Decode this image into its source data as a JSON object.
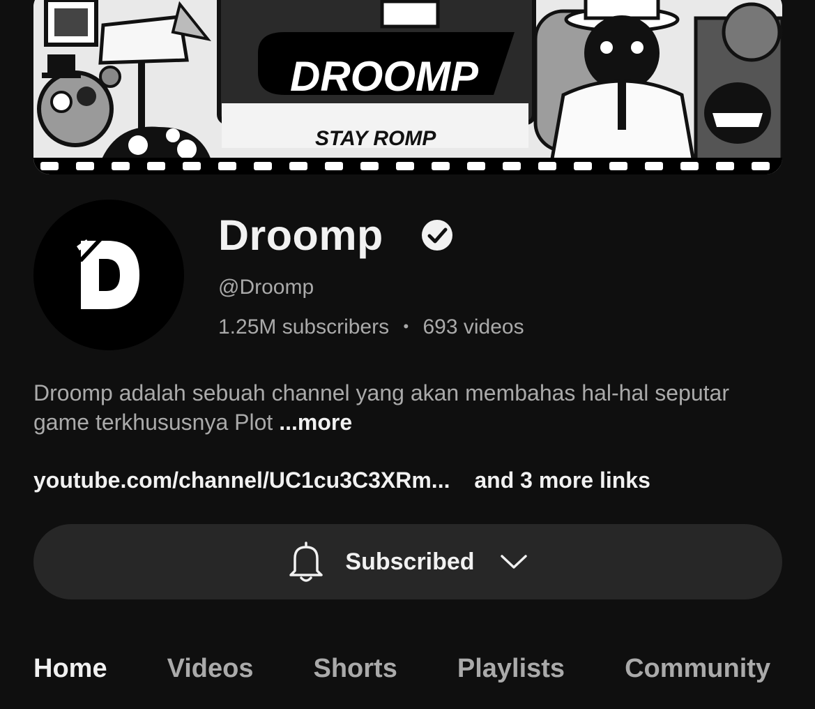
{
  "banner": {
    "logo_text": "DROOMP",
    "tagline": "STAY ROMP"
  },
  "channel": {
    "name": "Droomp",
    "verified": true,
    "handle": "@Droomp",
    "subscribers": "1.25M subscribers",
    "separator": "•",
    "videos": "693 videos",
    "description": "Droomp adalah sebuah channel yang akan membahas hal-hal seputar game terkhususnya Plot",
    "description_more": "...more",
    "link": "youtube.com/channel/UC1cu3C3XRm...",
    "more_links": "and 3 more links"
  },
  "subscribe": {
    "label": "Subscribed",
    "icon": "bell-icon",
    "dropdown_icon": "chevron-down-icon"
  },
  "tabs": [
    {
      "label": "Home",
      "active": true
    },
    {
      "label": "Videos",
      "active": false
    },
    {
      "label": "Shorts",
      "active": false
    },
    {
      "label": "Playlists",
      "active": false
    },
    {
      "label": "Community",
      "active": false
    }
  ],
  "colors": {
    "background": "#0f0f0f",
    "button_bg": "#272727",
    "text_primary": "#f1f1f1",
    "text_secondary": "#aaaaaa"
  }
}
